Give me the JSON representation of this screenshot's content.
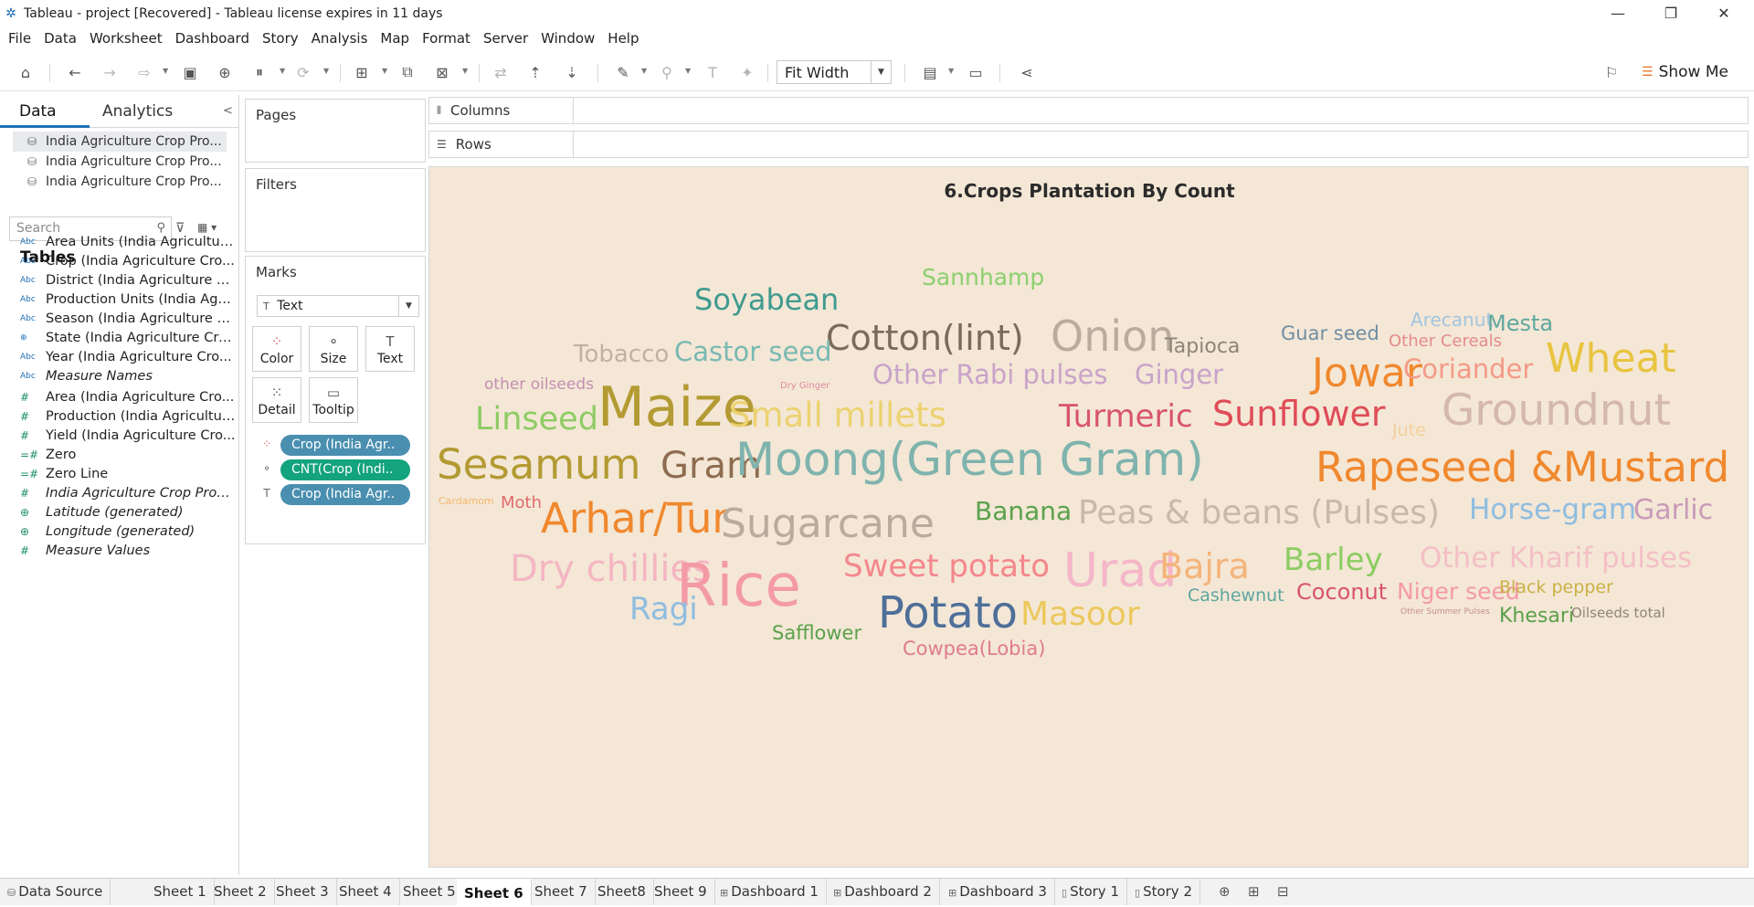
{
  "window": {
    "title": "Tableau - project [Recovered] - Tableau license expires in 11 days",
    "minimize": "—",
    "restore": "❐",
    "close": "✕"
  },
  "menu": [
    "File",
    "Data",
    "Worksheet",
    "Dashboard",
    "Story",
    "Analysis",
    "Map",
    "Format",
    "Server",
    "Window",
    "Help"
  ],
  "toolbar": {
    "fit": "Fit Width",
    "show_me": "Show Me"
  },
  "data_pane": {
    "tab_data": "Data",
    "tab_analytics": "Analytics",
    "sources": [
      "India Agriculture Crop Pro...",
      "India Agriculture Crop Pro...",
      "India Agriculture Crop Pro..."
    ],
    "search_placeholder": "Search",
    "tables_heading": "Tables",
    "fields": [
      {
        "type": "Abc",
        "name": "Area Units (India Agricultur...",
        "italic": false
      },
      {
        "type": "Abc",
        "name": "Crop (India Agriculture Cro...",
        "italic": false
      },
      {
        "type": "Abc",
        "name": "District (India Agriculture C...",
        "italic": false
      },
      {
        "type": "Abc",
        "name": "Production Units (India Agri...",
        "italic": false
      },
      {
        "type": "Abc",
        "name": "Season (India Agriculture C...",
        "italic": false
      },
      {
        "type": "globe",
        "name": "State (India Agriculture Cro...",
        "italic": false
      },
      {
        "type": "Abc",
        "name": "Year (India Agriculture Cro...",
        "italic": false
      },
      {
        "type": "Abc",
        "name": "Measure Names",
        "italic": true
      },
      {
        "type": "#",
        "name": "Area (India Agriculture Cro...",
        "italic": false
      },
      {
        "type": "#",
        "name": "Production (India Agricultur...",
        "italic": false
      },
      {
        "type": "#",
        "name": "Yield (India Agriculture Cro...",
        "italic": false
      },
      {
        "type": "=#",
        "name": "Zero",
        "italic": false
      },
      {
        "type": "=#",
        "name": "Zero Line",
        "italic": false
      },
      {
        "type": "#",
        "name": "India Agriculture Crop Prod...",
        "italic": true
      },
      {
        "type": "globe",
        "name": "Latitude (generated)",
        "italic": true
      },
      {
        "type": "globe",
        "name": "Longitude (generated)",
        "italic": true
      },
      {
        "type": "#",
        "name": "Measure Values",
        "italic": true
      }
    ]
  },
  "cards": {
    "pages": "Pages",
    "filters": "Filters",
    "marks": "Marks",
    "mark_type": "Text",
    "buttons": [
      "Color",
      "Size",
      "Text",
      "Detail",
      "Tooltip"
    ],
    "pills": [
      {
        "label": "Crop (India Agr..",
        "kind": "color",
        "color": "#4a8fb0"
      },
      {
        "label": "CNT(Crop (Indi..",
        "kind": "size",
        "color": "#13a37e"
      },
      {
        "label": "Crop (India Agr..",
        "kind": "text",
        "color": "#4a8fb0"
      }
    ]
  },
  "shelves": {
    "columns": "Columns",
    "rows": "Rows"
  },
  "viz": {
    "title": "6.Crops Plantation By Count",
    "background": "#f4e7d6"
  },
  "words": [
    {
      "text": "Sannhamp",
      "color": "#8ccf6e"
    },
    {
      "text": "Soyabean",
      "color": "#3f9a8f"
    },
    {
      "text": "Cotton(lint)",
      "color": "#7b6a5a"
    },
    {
      "text": "Onion",
      "color": "#b9ab9e"
    },
    {
      "text": "Tapioca",
      "color": "#8f8478"
    },
    {
      "text": "Guar seed",
      "color": "#6f8ea3"
    },
    {
      "text": "Arecanut",
      "color": "#a3c5e0"
    },
    {
      "text": "Mesta",
      "color": "#5ea79e"
    },
    {
      "text": "Other Cereals",
      "color": "#e58b8b"
    },
    {
      "text": "Tobacco",
      "color": "#bfb2a4"
    },
    {
      "text": "Castor seed",
      "color": "#79b9b2"
    },
    {
      "text": "Other Rabi pulses",
      "color": "#c9a3c9"
    },
    {
      "text": "Ginger",
      "color": "#c9a3c9"
    },
    {
      "text": "Jowar",
      "color": "#f0882e"
    },
    {
      "text": "Coriander",
      "color": "#f49a88"
    },
    {
      "text": "Wheat",
      "color": "#e8c440"
    },
    {
      "text": "other oilseeds",
      "color": "#c48fb1"
    },
    {
      "text": "Dry Ginger",
      "color": "#e08a9e"
    },
    {
      "text": "Maize",
      "color": "#b39a32"
    },
    {
      "text": "Linseed",
      "color": "#8dcc63"
    },
    {
      "text": "Small millets",
      "color": "#ecd271"
    },
    {
      "text": "Turmeric",
      "color": "#d9546b"
    },
    {
      "text": "Sunflower",
      "color": "#df4c57"
    },
    {
      "text": "Jute",
      "color": "#f4cf9c"
    },
    {
      "text": "Groundnut",
      "color": "#d4b7ad"
    },
    {
      "text": "Sesamum",
      "color": "#b39a32"
    },
    {
      "text": "Gram",
      "color": "#8d6c50"
    },
    {
      "text": "Moong(Green Gram)",
      "color": "#7fb3ad"
    },
    {
      "text": "Rapeseed &Mustard",
      "color": "#f0882e"
    },
    {
      "text": "Cardamom",
      "color": "#f4b76a"
    },
    {
      "text": "Moth",
      "color": "#df6b6b"
    },
    {
      "text": "Arhar/Tur",
      "color": "#f0882e"
    },
    {
      "text": "Sugarcane",
      "color": "#b9ab9e"
    },
    {
      "text": "Banana",
      "color": "#5aa14b"
    },
    {
      "text": "Peas & beans (Pulses)",
      "color": "#c9b8ab"
    },
    {
      "text": "Horse-gram",
      "color": "#8fbde0"
    },
    {
      "text": "Garlic",
      "color": "#c99ab8"
    },
    {
      "text": "Dry chillies",
      "color": "#f4b6c2"
    },
    {
      "text": "Rice",
      "color": "#f49aa6"
    },
    {
      "text": "Sweet potato",
      "color": "#f4878c"
    },
    {
      "text": "Urad",
      "color": "#f4b6c8"
    },
    {
      "text": "Bajra",
      "color": "#f4b47a"
    },
    {
      "text": "Barley",
      "color": "#8dcc63"
    },
    {
      "text": "Other Kharif pulses",
      "color": "#f4bfc6"
    },
    {
      "text": "Cashewnut",
      "color": "#5ea79e"
    },
    {
      "text": "Coconut",
      "color": "#d9546b"
    },
    {
      "text": "Niger seed",
      "color": "#f49aa6"
    },
    {
      "text": "Black pepper",
      "color": "#c9b146"
    },
    {
      "text": "Ragi",
      "color": "#8fbde0"
    },
    {
      "text": "Potato",
      "color": "#4e6f99"
    },
    {
      "text": "Masoor",
      "color": "#ecc85c"
    },
    {
      "text": "Other Summer Pulses",
      "color": "#c48f8f"
    },
    {
      "text": "Khesari",
      "color": "#5aa14b"
    },
    {
      "text": "Oilseeds total",
      "color": "#8f8478"
    },
    {
      "text": "Safflower",
      "color": "#5aa14b"
    },
    {
      "text": "Cowpea(Lobia)",
      "color": "#e07a8e"
    }
  ],
  "sheet_tabs": [
    {
      "label": "Data Source",
      "kind": "datasource"
    },
    {
      "label": "Sheet 1",
      "kind": "sheet"
    },
    {
      "label": "Sheet 2",
      "kind": "sheet"
    },
    {
      "label": "Sheet 3",
      "kind": "sheet"
    },
    {
      "label": "Sheet 4",
      "kind": "sheet"
    },
    {
      "label": "Sheet 5",
      "kind": "sheet"
    },
    {
      "label": "Sheet 6",
      "kind": "sheet",
      "active": true
    },
    {
      "label": "Sheet 7",
      "kind": "sheet"
    },
    {
      "label": "Sheet8",
      "kind": "sheet"
    },
    {
      "label": "Sheet 9",
      "kind": "sheet"
    },
    {
      "label": "Dashboard 1",
      "kind": "dashboard"
    },
    {
      "label": "Dashboard 2",
      "kind": "dashboard"
    },
    {
      "label": "Dashboard 3",
      "kind": "dashboard"
    },
    {
      "label": "Story 1",
      "kind": "story"
    },
    {
      "label": "Story 2",
      "kind": "story"
    }
  ]
}
